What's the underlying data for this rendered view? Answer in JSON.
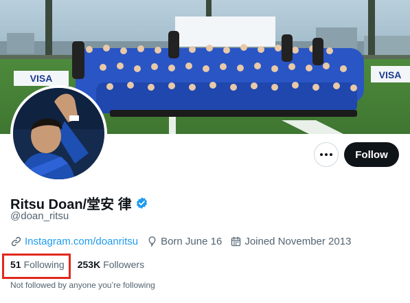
{
  "profile": {
    "display_name": "Ritsu Doan/堂安 律",
    "handle": "@doan_ritsu",
    "verified": true,
    "link_text": "Instagram.com/doanritsu",
    "born": "Born June 16",
    "joined": "Joined November 2013"
  },
  "stats": {
    "following_count": "51",
    "following_label": "Following",
    "followers_count": "253K",
    "followers_label": "Followers"
  },
  "actions": {
    "follow_label": "Follow"
  },
  "social_context": "Not followed by anyone you’re following",
  "banner": {
    "sponsor_text": "VISA"
  },
  "icons": {
    "more": "more-dots-icon",
    "verified": "verified-badge-icon",
    "link": "link-icon",
    "birthday": "balloon-icon",
    "joined": "calendar-icon"
  },
  "colors": {
    "accent": "#1d9bf0",
    "follow_button": "#0f1419",
    "highlight_box": "#e0281c",
    "muted_text": "#536471"
  }
}
